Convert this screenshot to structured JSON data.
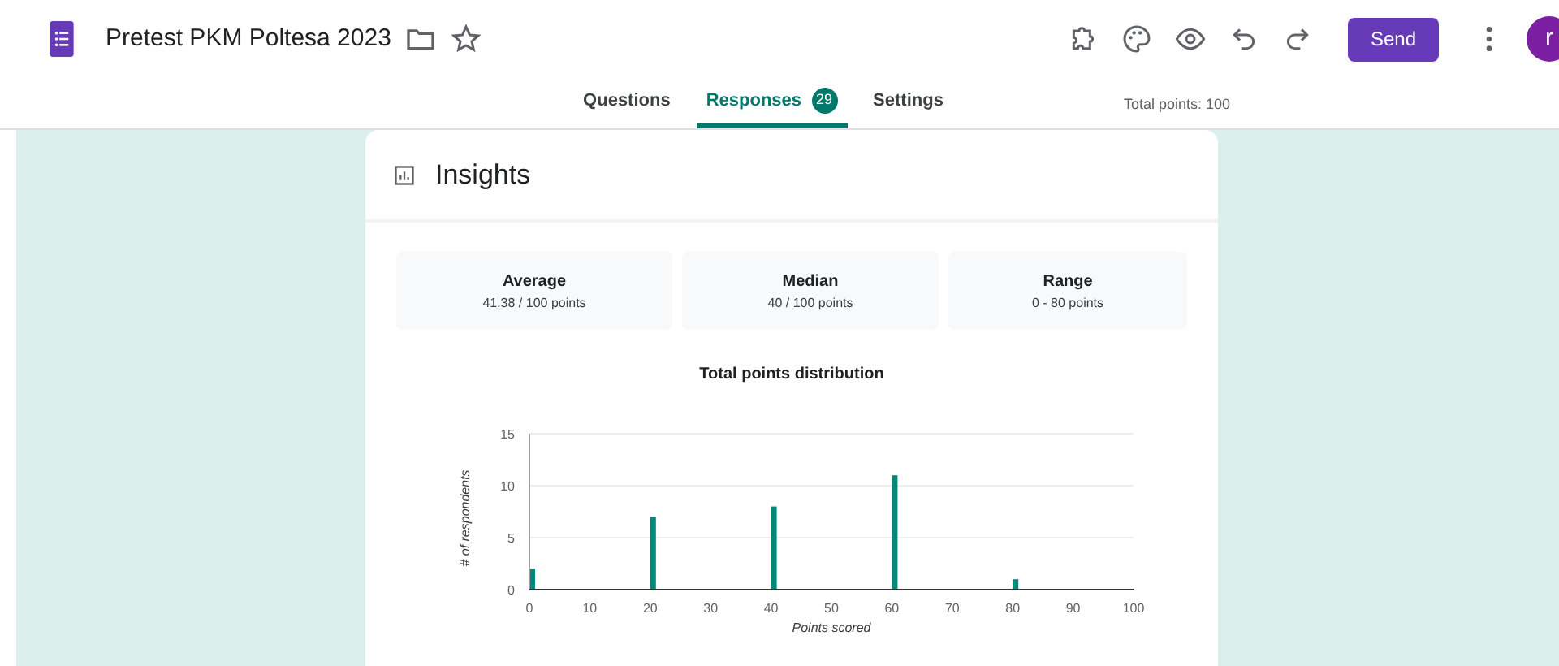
{
  "header": {
    "title": "Pretest PKM Poltesa 2023",
    "send_button": "Send",
    "avatar": "r"
  },
  "tabs": [
    {
      "label": "Questions",
      "selected": false
    },
    {
      "label": "Responses",
      "selected": true,
      "badge": "29"
    },
    {
      "label": "Settings",
      "selected": false
    }
  ],
  "total_points": "Total points: 100",
  "insights": {
    "title": "Insights",
    "stats": [
      {
        "label": "Average",
        "value": "41.38 / 100 points"
      },
      {
        "label": "Median",
        "value": "40 / 100 points"
      },
      {
        "label": "Range",
        "value": "0 - 80 points"
      }
    ],
    "chart_data": {
      "type": "bar",
      "title": "Total points distribution",
      "xlabel": "Points scored",
      "ylabel": "# of respondents",
      "x": [
        0,
        20,
        40,
        60,
        80
      ],
      "series": [
        {
          "color": "#00897b",
          "values": [
            2,
            7,
            8,
            11,
            1
          ]
        }
      ],
      "xlim": [
        0,
        100
      ],
      "ylim": [
        0,
        15
      ],
      "xticks": [
        0,
        10,
        20,
        30,
        40,
        50,
        60,
        70,
        80,
        90,
        100
      ],
      "yticks": [
        0,
        5,
        10,
        15
      ]
    }
  }
}
